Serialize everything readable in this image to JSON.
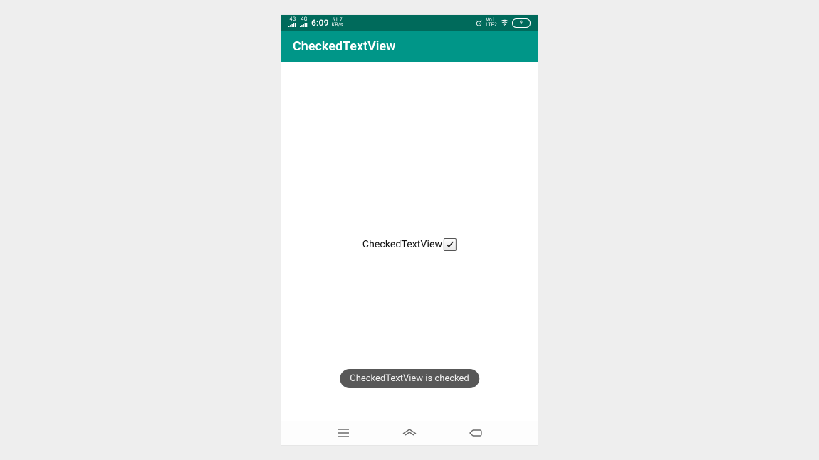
{
  "status": {
    "signal_label": "4G",
    "time": "6:09",
    "data_rate": "61.7",
    "data_unit": "KB/s",
    "volte_label": "Vo1\nLTE2",
    "battery_text": "9"
  },
  "app_bar": {
    "title": "CheckedTextView"
  },
  "content": {
    "ctv_label": "CheckedTextView",
    "ctv_checked": true
  },
  "toast": {
    "message": "CheckedTextView is checked"
  }
}
